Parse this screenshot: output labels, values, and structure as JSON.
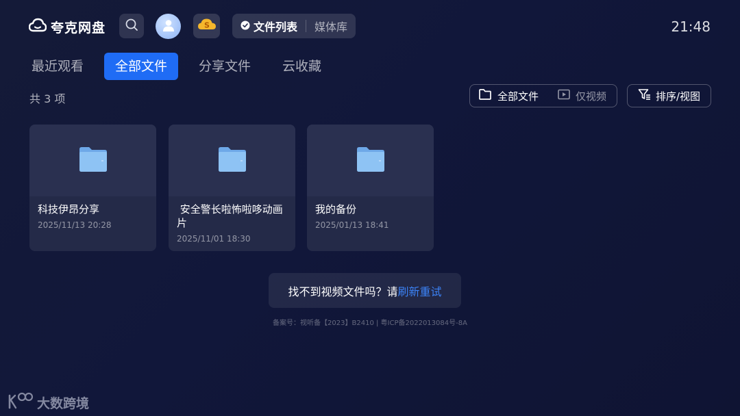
{
  "app": {
    "name": "夸克网盘"
  },
  "header": {
    "segments": {
      "active": "文件列表",
      "inactive": "媒体库"
    },
    "clock": "21:48"
  },
  "tabs": [
    {
      "label": "最近观看",
      "selected": false
    },
    {
      "label": "全部文件",
      "selected": true
    },
    {
      "label": "分享文件",
      "selected": false
    },
    {
      "label": "云收藏",
      "selected": false
    }
  ],
  "summary": {
    "count_text": "共 3 项"
  },
  "filter": {
    "all_label": "全部文件",
    "video_label": "仅视频"
  },
  "sort": {
    "label": "排序/视图"
  },
  "files": [
    {
      "name": "科技伊昂分享",
      "date": "2025/11/13 20:28"
    },
    {
      "name": " 安全警长啦怖啦哆动画片",
      "date": "2025/11/01 18:30"
    },
    {
      "name": "我的备份",
      "date": "2025/01/13 18:41"
    }
  ],
  "notice": {
    "text": "找不到视频文件吗？请",
    "link": "刷新重试"
  },
  "footer": {
    "icp": "备案号：视听备【2023】B2410 | 粤ICP备2022013084号-8A"
  },
  "watermark": {
    "text": "大数跨境"
  },
  "colors": {
    "accent": "#1f6cf5",
    "link": "#3b82f6",
    "folder": "#7fb6ee"
  }
}
